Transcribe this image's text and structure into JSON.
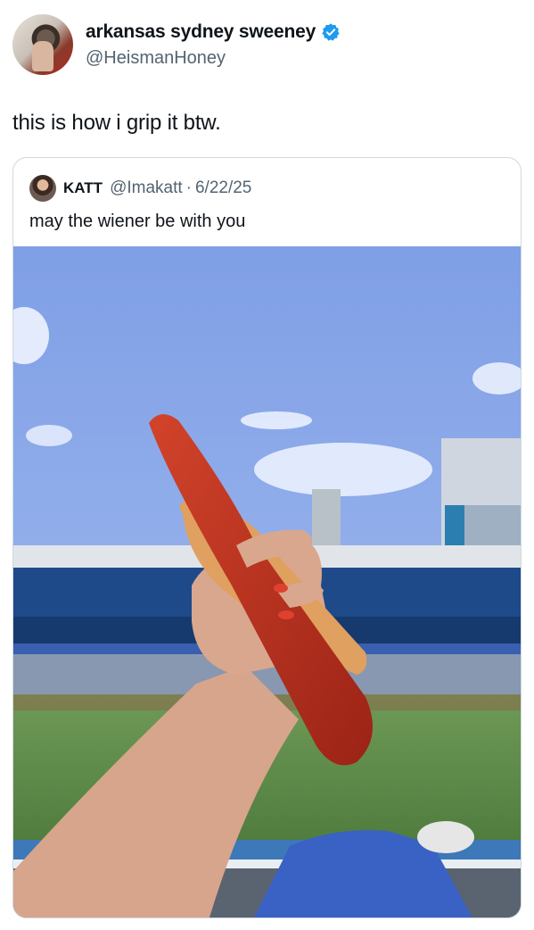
{
  "tweet": {
    "display_name": "arkansas sydney sweeney",
    "handle": "@HeismanHoney",
    "text": "this is how i grip it btw.",
    "verified_icon": "verified-badge-icon",
    "verified_color": "#1d9bf0"
  },
  "quoted": {
    "name": "KATT",
    "handle": "@Imakatt",
    "separator": "·",
    "date": "6/22/25",
    "text": "may the wiener be with you",
    "media_description_icon": "photo"
  },
  "colors": {
    "text_primary": "#0f1419",
    "text_secondary": "#536471",
    "border": "#cfd9de"
  }
}
